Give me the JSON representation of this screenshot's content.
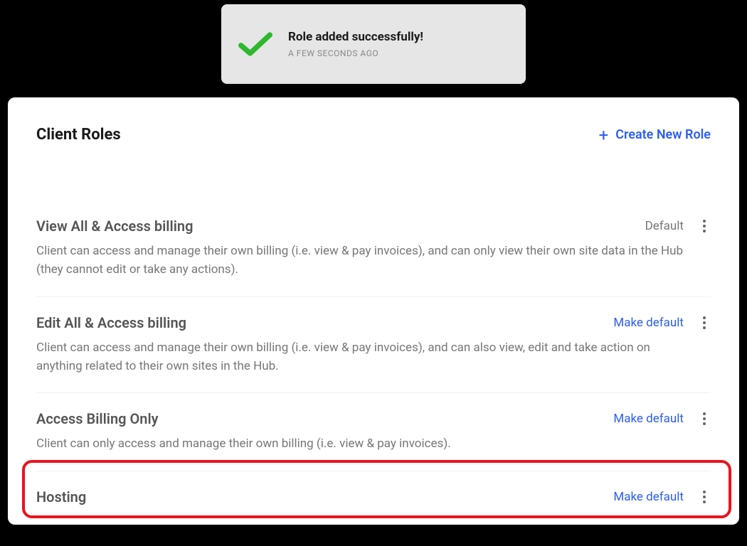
{
  "toast": {
    "title": "Role added successfully!",
    "time": "A FEW SECONDS AGO"
  },
  "panel": {
    "title": "Client Roles",
    "create_button": "Create New Role"
  },
  "roles": [
    {
      "name": "View All & Access billing",
      "description": "Client can access and manage their own billing (i.e. view & pay invoices), and can only view their own site data in the Hub (they cannot edit or take any actions).",
      "action_label": "Default",
      "is_default": true
    },
    {
      "name": "Edit All & Access billing",
      "description": "Client can access and manage their own billing (i.e. view & pay invoices), and can also view, edit and take action on anything related to their own sites in the Hub.",
      "action_label": "Make default",
      "is_default": false
    },
    {
      "name": "Access Billing Only",
      "description": "Client can only access and manage their own billing (i.e. view & pay invoices).",
      "action_label": "Make default",
      "is_default": false
    },
    {
      "name": "Hosting",
      "description": "",
      "action_label": "Make default",
      "is_default": false
    }
  ]
}
